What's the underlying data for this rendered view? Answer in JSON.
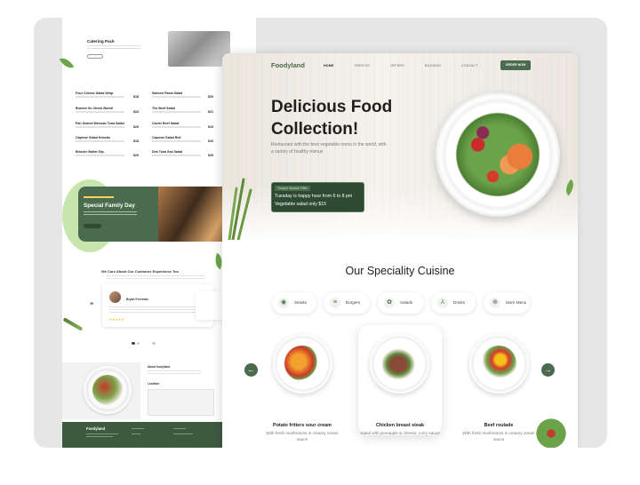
{
  "left_page": {
    "feature": {
      "title": "Catering Pack"
    },
    "menu_items": [
      {
        "name": "Four Cheese Salad Wrap",
        "price": "$18"
      },
      {
        "name": "Salmon Pasta Salad",
        "price": "$20"
      },
      {
        "name": "Burned On Cheek Boesli",
        "price": "$23"
      },
      {
        "name": "The Beef Salad",
        "price": "$21"
      },
      {
        "name": "Pan Seared Mexican Tuna Salad",
        "price": "$20"
      },
      {
        "name": "Cavier Beef Salad",
        "price": "$19"
      },
      {
        "name": "Caprese Salad Kebobs",
        "price": "$18"
      },
      {
        "name": "Caprese Salad Roll",
        "price": "$16"
      },
      {
        "name": "Brioche Butter Dip",
        "price": "$20"
      },
      {
        "name": "Dim Tuna Sea Salad",
        "price": "$25"
      }
    ],
    "banner": {
      "title": "Special Family Day"
    },
    "testimonials": {
      "title": "We Care About Our Customer Experience Too",
      "reviewer": "Bryan Freeman",
      "stars": "★★★★★"
    },
    "footer": {
      "logo": "Foodyland",
      "about": "About foodyland",
      "location": "Location"
    }
  },
  "header": {
    "logo": "Foodyland",
    "nav": [
      "HOME",
      "SERVICE",
      "OFFERS",
      "BOOKING",
      "CONTACT"
    ],
    "cta": "ORDER NOW"
  },
  "hero": {
    "title": "Delicious Food Collection!",
    "subtitle": "Restaurant with the best vegetable menu in the world, with a variety of healthy menus",
    "offer_label": "Today's Special Offer",
    "offer_text": "Tuesday is happy hour from 6 to 8 pm Vegetable salad only $15"
  },
  "speciality": {
    "title": "Our Speciality Cuisine",
    "categories": [
      {
        "label": "Steaks",
        "icon": "steak-icon"
      },
      {
        "label": "Burgers",
        "icon": "burger-icon"
      },
      {
        "label": "Salads",
        "icon": "salad-icon"
      },
      {
        "label": "Drinks",
        "icon": "drink-icon"
      },
      {
        "label": "More Menu",
        "icon": "more-menu-icon"
      }
    ],
    "dishes": [
      {
        "name": "Potato fritters sour cream",
        "desc": "With fresh mushrooms in creamy cream sauce"
      },
      {
        "name": "Chicken breast steak",
        "desc": "Salad with pineapple & cheese, curry sauce"
      },
      {
        "name": "Beef roulade",
        "desc": "With fresh mushrooms in creamy cream sauce"
      }
    ]
  },
  "colors": {
    "brand_green": "#4b6b4f",
    "dark_green": "#2f4a33",
    "text_dark": "#1f1f1f"
  }
}
